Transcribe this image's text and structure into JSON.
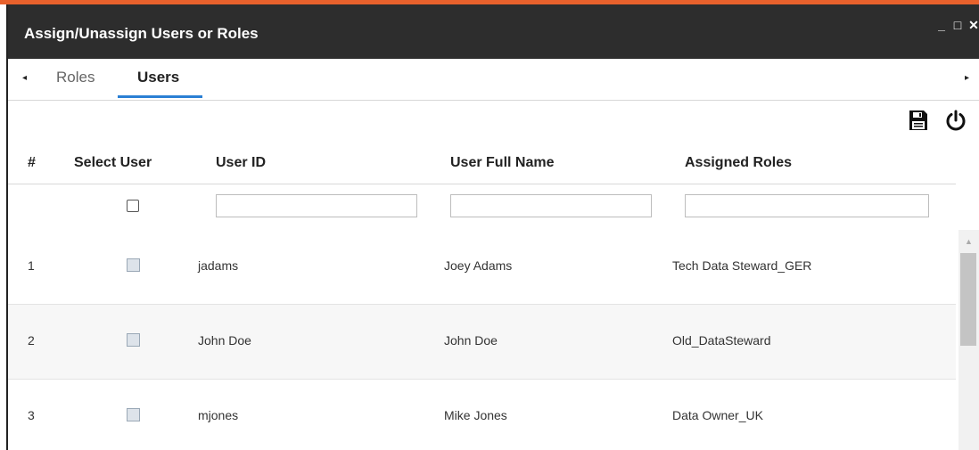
{
  "colors": {
    "accent": "#e8612c",
    "title_bar": "#2d2d2d",
    "tab_underline": "#2a7fd4"
  },
  "window": {
    "title": "Assign/Unassign Users or Roles",
    "controls": {
      "minimize": "_",
      "maximize": "□",
      "close": "✕"
    }
  },
  "tabs": {
    "left_arrow": "◂",
    "right_arrow": "▸",
    "items": [
      {
        "label": "Roles",
        "active": false
      },
      {
        "label": "Users",
        "active": true
      }
    ]
  },
  "toolbar": {
    "icons": [
      "save-icon",
      "power-icon"
    ]
  },
  "table": {
    "columns": [
      "#",
      "Select User",
      "User ID",
      "User Full Name",
      "Assigned Roles"
    ],
    "filters": {
      "user_id": "",
      "user_full_name": "",
      "assigned_roles": ""
    },
    "rows": [
      {
        "num": "1",
        "user_id": "jadams",
        "full_name": "Joey Adams",
        "roles": "Tech Data Steward_GER"
      },
      {
        "num": "2",
        "user_id": "John Doe",
        "full_name": "John Doe",
        "roles": "Old_DataSteward"
      },
      {
        "num": "3",
        "user_id": "mjones",
        "full_name": "Mike Jones",
        "roles": "Data Owner_UK"
      }
    ]
  },
  "scrollbar": {
    "up_arrow": "▲"
  }
}
